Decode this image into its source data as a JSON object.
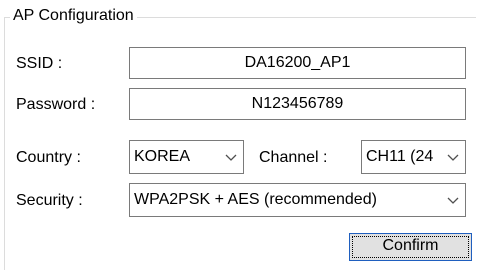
{
  "group": {
    "title": "AP Configuration"
  },
  "ssid": {
    "label": "SSID :",
    "value": "DA16200_AP1"
  },
  "password": {
    "label": "Password :",
    "value": "N123456789"
  },
  "country": {
    "label": "Country :",
    "selected": "KOREA"
  },
  "channel": {
    "label": "Channel :",
    "selected": "CH11 (24"
  },
  "security": {
    "label": "Security :",
    "selected": "WPA2PSK + AES (recommended)"
  },
  "actions": {
    "confirm_label": "Confirm"
  },
  "icons": {
    "dropdown": "chevron-down-icon"
  },
  "colors": {
    "field_border": "#7a7a7a",
    "button_border": "#1f5fbf",
    "button_face": "#e1e1e1",
    "group_border": "#dcdcdc"
  }
}
